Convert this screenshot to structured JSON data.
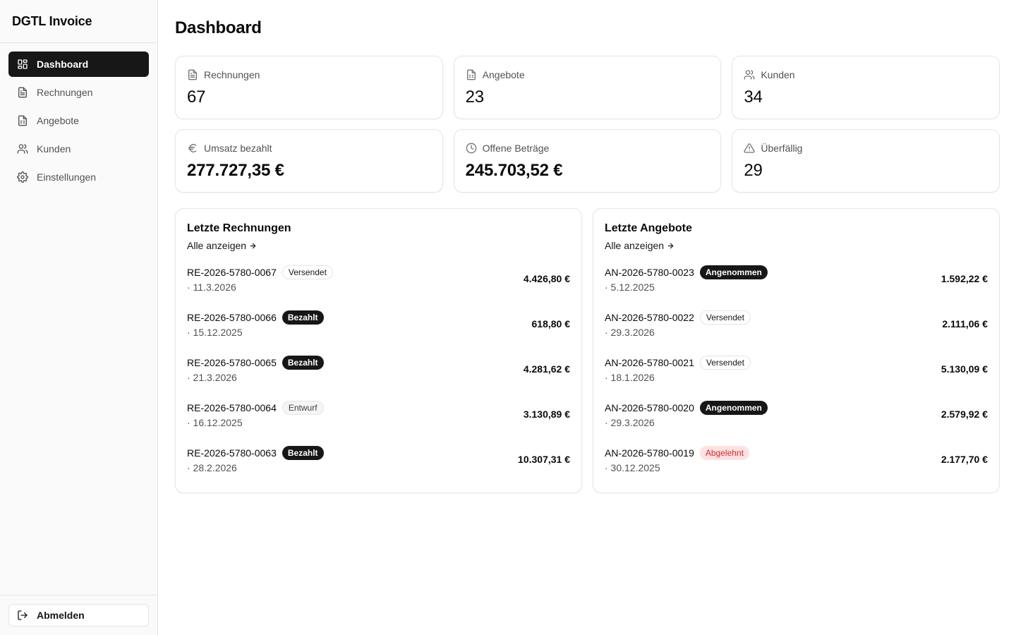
{
  "app": {
    "title": "DGTL Invoice"
  },
  "sidebar": {
    "items": [
      {
        "label": "Dashboard",
        "icon": "dashboard-icon",
        "active": true
      },
      {
        "label": "Rechnungen",
        "icon": "file-icon"
      },
      {
        "label": "Angebote",
        "icon": "file-lines-icon"
      },
      {
        "label": "Kunden",
        "icon": "users-icon"
      },
      {
        "label": "Einstellungen",
        "icon": "gear-icon"
      }
    ],
    "logout_label": "Abmelden"
  },
  "page": {
    "title": "Dashboard"
  },
  "stats": [
    {
      "label": "Rechnungen",
      "value": "67",
      "icon": "file-icon"
    },
    {
      "label": "Angebote",
      "value": "23",
      "icon": "file-lines-icon"
    },
    {
      "label": "Kunden",
      "value": "34",
      "icon": "users-icon"
    },
    {
      "label": "Umsatz bezahlt",
      "value": "277.727,35 €",
      "icon": "euro-icon"
    },
    {
      "label": "Offene Beträge",
      "value": "245.703,52 €",
      "icon": "clock-icon"
    },
    {
      "label": "Überfällig",
      "value": "29",
      "icon": "warning-icon"
    }
  ],
  "invoices": {
    "title": "Letzte Rechnungen",
    "link": "Alle anzeigen",
    "rows": [
      {
        "number": "RE-2026-5780-0067",
        "status": "Versendet",
        "date": "· 11.3.2026",
        "amount": "4.426,80 €"
      },
      {
        "number": "RE-2026-5780-0066",
        "status": "Bezahlt",
        "date": "· 15.12.2025",
        "amount": "618,80 €"
      },
      {
        "number": "RE-2026-5780-0065",
        "status": "Bezahlt",
        "date": "· 21.3.2026",
        "amount": "4.281,62 €"
      },
      {
        "number": "RE-2026-5780-0064",
        "status": "Entwurf",
        "date": "· 16.12.2025",
        "amount": "3.130,89 €"
      },
      {
        "number": "RE-2026-5780-0063",
        "status": "Bezahlt",
        "date": "· 28.2.2026",
        "amount": "10.307,31 €"
      }
    ]
  },
  "quotes": {
    "title": "Letzte Angebote",
    "link": "Alle anzeigen",
    "rows": [
      {
        "number": "AN-2026-5780-0023",
        "status": "Angenommen",
        "date": "· 5.12.2025",
        "amount": "1.592,22 €"
      },
      {
        "number": "AN-2026-5780-0022",
        "status": "Versendet",
        "date": "· 29.3.2026",
        "amount": "2.111,06 €"
      },
      {
        "number": "AN-2026-5780-0021",
        "status": "Versendet",
        "date": "· 18.1.2026",
        "amount": "5.130,09 €"
      },
      {
        "number": "AN-2026-5780-0020",
        "status": "Angenommen",
        "date": "· 29.3.2026",
        "amount": "2.579,92 €"
      },
      {
        "number": "AN-2026-5780-0019",
        "status": "Abgelehnt",
        "date": "· 30.12.2025",
        "amount": "2.177,70 €"
      }
    ]
  },
  "colors": {
    "primary": "#171717",
    "border": "#e5e5e5",
    "muted_text": "#525252",
    "danger_bg": "#fee2e2",
    "danger_text": "#dc2626"
  }
}
